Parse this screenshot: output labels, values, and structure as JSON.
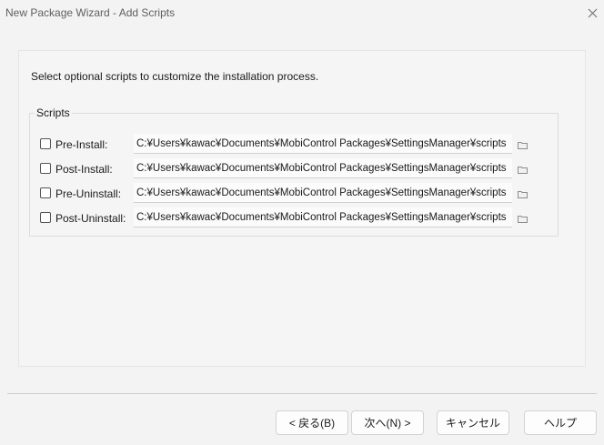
{
  "window": {
    "title": "New Package Wizard - Add Scripts"
  },
  "instruction": "Select optional scripts to customize the installation process.",
  "scripts_group": {
    "legend": "Scripts",
    "rows": [
      {
        "label": "Pre-Install:",
        "checked": false,
        "path": "C:¥Users¥kawac¥Documents¥MobiControl Packages¥SettingsManager¥scripts"
      },
      {
        "label": "Post-Install:",
        "checked": false,
        "path": "C:¥Users¥kawac¥Documents¥MobiControl Packages¥SettingsManager¥scripts"
      },
      {
        "label": "Pre-Uninstall:",
        "checked": false,
        "path": "C:¥Users¥kawac¥Documents¥MobiControl Packages¥SettingsManager¥scripts"
      },
      {
        "label": "Post-Uninstall:",
        "checked": false,
        "path": "C:¥Users¥kawac¥Documents¥MobiControl Packages¥SettingsManager¥scripts"
      }
    ]
  },
  "buttons": {
    "back": "< 戻る(B)",
    "next": "次へ(N) >",
    "cancel": "キャンセル",
    "help": "ヘルプ"
  },
  "icons": {
    "close": "close-icon",
    "browse": "folder-icon"
  },
  "colors": {
    "background": "#f3f3f3",
    "panel": "#f5f5f5"
  }
}
